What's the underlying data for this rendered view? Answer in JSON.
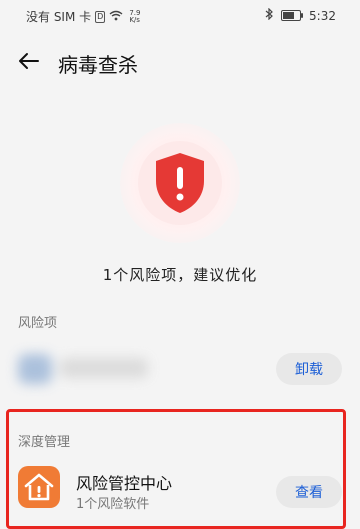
{
  "status_bar": {
    "carrier": "没有 SIM 卡",
    "sim_badge": "D",
    "net_speed_value": "7.9",
    "net_speed_unit": "K/s",
    "time": "5:32"
  },
  "app_bar": {
    "title": "病毒查杀"
  },
  "summary": {
    "text": "1个风险项，建议优化"
  },
  "risk_section": {
    "header": "风险项",
    "action_label": "卸载"
  },
  "deep_section": {
    "header": "深度管理",
    "app_name": "风险管控中心",
    "app_subtitle": "1个风险软件",
    "action_label": "查看"
  },
  "colors": {
    "accent_blue": "#1d5fd6",
    "shield_red": "#e53935",
    "highlight_red": "#e8251f",
    "app_icon_orange": "#f07b35"
  },
  "icons": [
    "wifi-icon",
    "bluetooth-icon",
    "battery-icon",
    "back-arrow-icon",
    "shield-alert-icon",
    "house-alert-icon"
  ]
}
